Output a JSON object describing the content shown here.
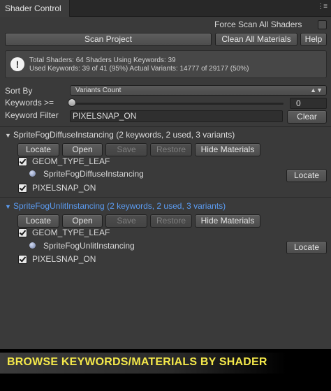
{
  "window": {
    "tab_title": "Shader Control",
    "menu_glyph": "⋮≡"
  },
  "options": {
    "force_scan_label": "Force Scan All Shaders",
    "force_scan_checked": false
  },
  "toolbar": {
    "scan_project": "Scan Project",
    "clean_materials": "Clean All Materials",
    "help": "Help"
  },
  "info": {
    "icon": "info-icon",
    "line1": "Total Shaders: 64  Shaders Using Keywords: 39",
    "line2": "Used Keywords: 39 of 41 (95%)  Actual Variants: 14777 of 29177 (50%)"
  },
  "filters": {
    "sort_by_label": "Sort By",
    "sort_by_value": "Variants Count",
    "keywords_label": "Keywords >=",
    "keywords_value": "0",
    "keywords_slider_fraction": 0,
    "keyword_filter_label": "Keyword Filter",
    "keyword_filter_value": "PIXELSNAP_ON",
    "clear": "Clear"
  },
  "shaders": [
    {
      "title": "SpriteFogDiffuseInstancing (2 keywords, 2 used, 3 variants)",
      "highlighted": false,
      "buttons": {
        "locate": "Locate",
        "open": "Open",
        "save": "Save",
        "restore": "Restore",
        "hide": "Hide Materials"
      },
      "keyword1": "GEOM_TYPE_LEAF",
      "material": "SpriteFogDiffuseInstancing",
      "material_locate": "Locate",
      "keyword2": "PIXELSNAP_ON"
    },
    {
      "title": "SpriteFogUnlitInstancing (2 keywords, 2 used, 3 variants)",
      "highlighted": true,
      "buttons": {
        "locate": "Locate",
        "open": "Open",
        "save": "Save",
        "restore": "Restore",
        "hide": "Hide Materials"
      },
      "keyword1": "GEOM_TYPE_LEAF",
      "material": "SpriteFogUnlitInstancing",
      "material_locate": "Locate",
      "keyword2": "PIXELSNAP_ON"
    }
  ],
  "banner": {
    "text": "BROWSE KEYWORDS/MATERIALS BY SHADER"
  },
  "colors": {
    "background": "#3a3a3a",
    "highlight": "#5b9bf0",
    "banner_text": "#f4e84a"
  }
}
